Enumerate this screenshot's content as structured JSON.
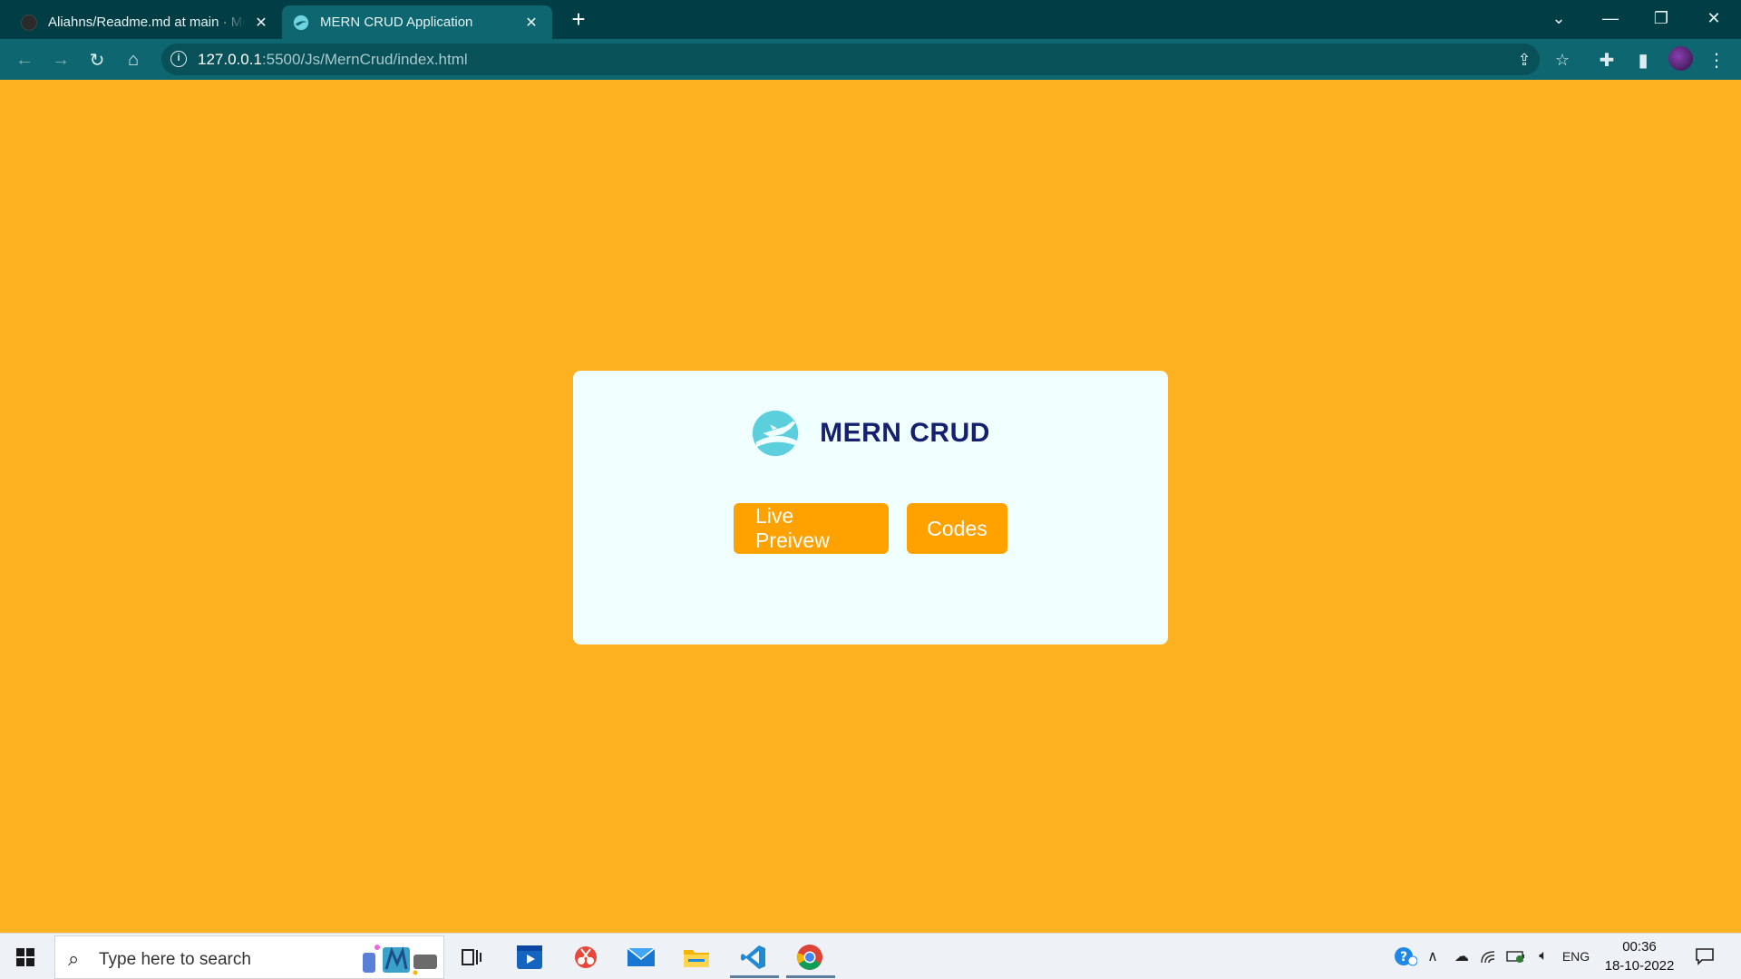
{
  "browser": {
    "tabs": [
      {
        "title": "Aliahns/Readme.md at main · Mo",
        "active": false
      },
      {
        "title": "MERN CRUD Application",
        "active": true
      }
    ],
    "new_tab": "+",
    "url_host": "127.0.0.1",
    "url_rest": ":5500/Js/MernCrud/index.html"
  },
  "page": {
    "background_color": "#ffb221",
    "card": {
      "brand_name": "MERN CRUD",
      "buttons": {
        "live": "Live Preivew",
        "codes": "Codes"
      },
      "accent_color": "#ffa200",
      "title_color": "#16206e"
    }
  },
  "taskbar": {
    "search_placeholder": "Type here to search",
    "apps": [
      "task-view-icon",
      "video-player-icon",
      "snip-tool-icon",
      "mail-icon",
      "file-explorer-icon",
      "vscode-icon",
      "chrome-icon"
    ],
    "tray": {
      "language": "ENG",
      "time": "00:36",
      "date": "18-10-2022"
    }
  }
}
